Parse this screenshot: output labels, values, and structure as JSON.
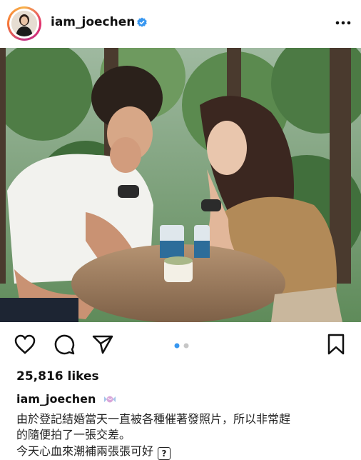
{
  "header": {
    "username": "iam_joechen",
    "verified_icon": "verified-badge-icon",
    "more_icon": "more-options-icon"
  },
  "post": {
    "image_alt": "couple-at-cafe-table-photo",
    "carousel": {
      "count": 2,
      "active": 1
    }
  },
  "actions": {
    "like_icon": "heart-icon",
    "comment_icon": "comment-icon",
    "share_icon": "send-icon",
    "save_icon": "bookmark-icon"
  },
  "likes_text": "25,816 likes",
  "caption": {
    "username": "iam_joechen",
    "emoji_icon": "candy-emoji-icon",
    "line1": "由於登記結婚當天一直被各種催著發照片，所以非常趕",
    "line2": "的隨便拍了一張交差。",
    "line3": "今天心血來潮補兩張張可好",
    "line3_icon": "?"
  },
  "colors": {
    "text": "#111111",
    "verified_blue": "#3897f0",
    "active_dot": "#3897f0",
    "inactive_dot": "#c7c7c7"
  }
}
